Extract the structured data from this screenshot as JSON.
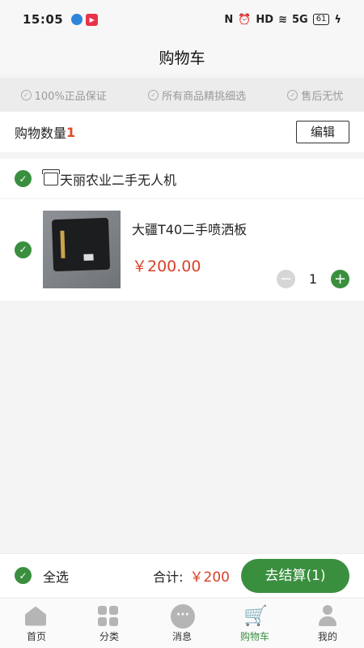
{
  "status_bar": {
    "time": "15:05",
    "network": "5G",
    "hd_label": "HD",
    "battery": "61"
  },
  "header": {
    "title": "购物车"
  },
  "guarantees": [
    {
      "label": "100%正品保证"
    },
    {
      "label": "所有商品精挑细选"
    },
    {
      "label": "售后无忧"
    }
  ],
  "cart_summary": {
    "count_label": "购物数量",
    "count": "1",
    "edit_label": "编辑"
  },
  "shop": {
    "name": "天丽农业二手无人机",
    "product": {
      "name": "大疆T40二手喷洒板",
      "price": "￥200.00",
      "quantity": "1"
    }
  },
  "checkout": {
    "select_all_label": "全选",
    "total_label": "合计:",
    "total_value": "￥200",
    "button_label": "去结算(1)"
  },
  "tabs": [
    {
      "label": "首页",
      "icon": "home-icon"
    },
    {
      "label": "分类",
      "icon": "category-icon"
    },
    {
      "label": "消息",
      "icon": "message-icon"
    },
    {
      "label": "购物车",
      "icon": "cart-icon",
      "active": true
    },
    {
      "label": "我的",
      "icon": "user-icon"
    }
  ],
  "colors": {
    "accent": "#3a8f3f",
    "price": "#d9412a",
    "count": "#e14a26"
  }
}
